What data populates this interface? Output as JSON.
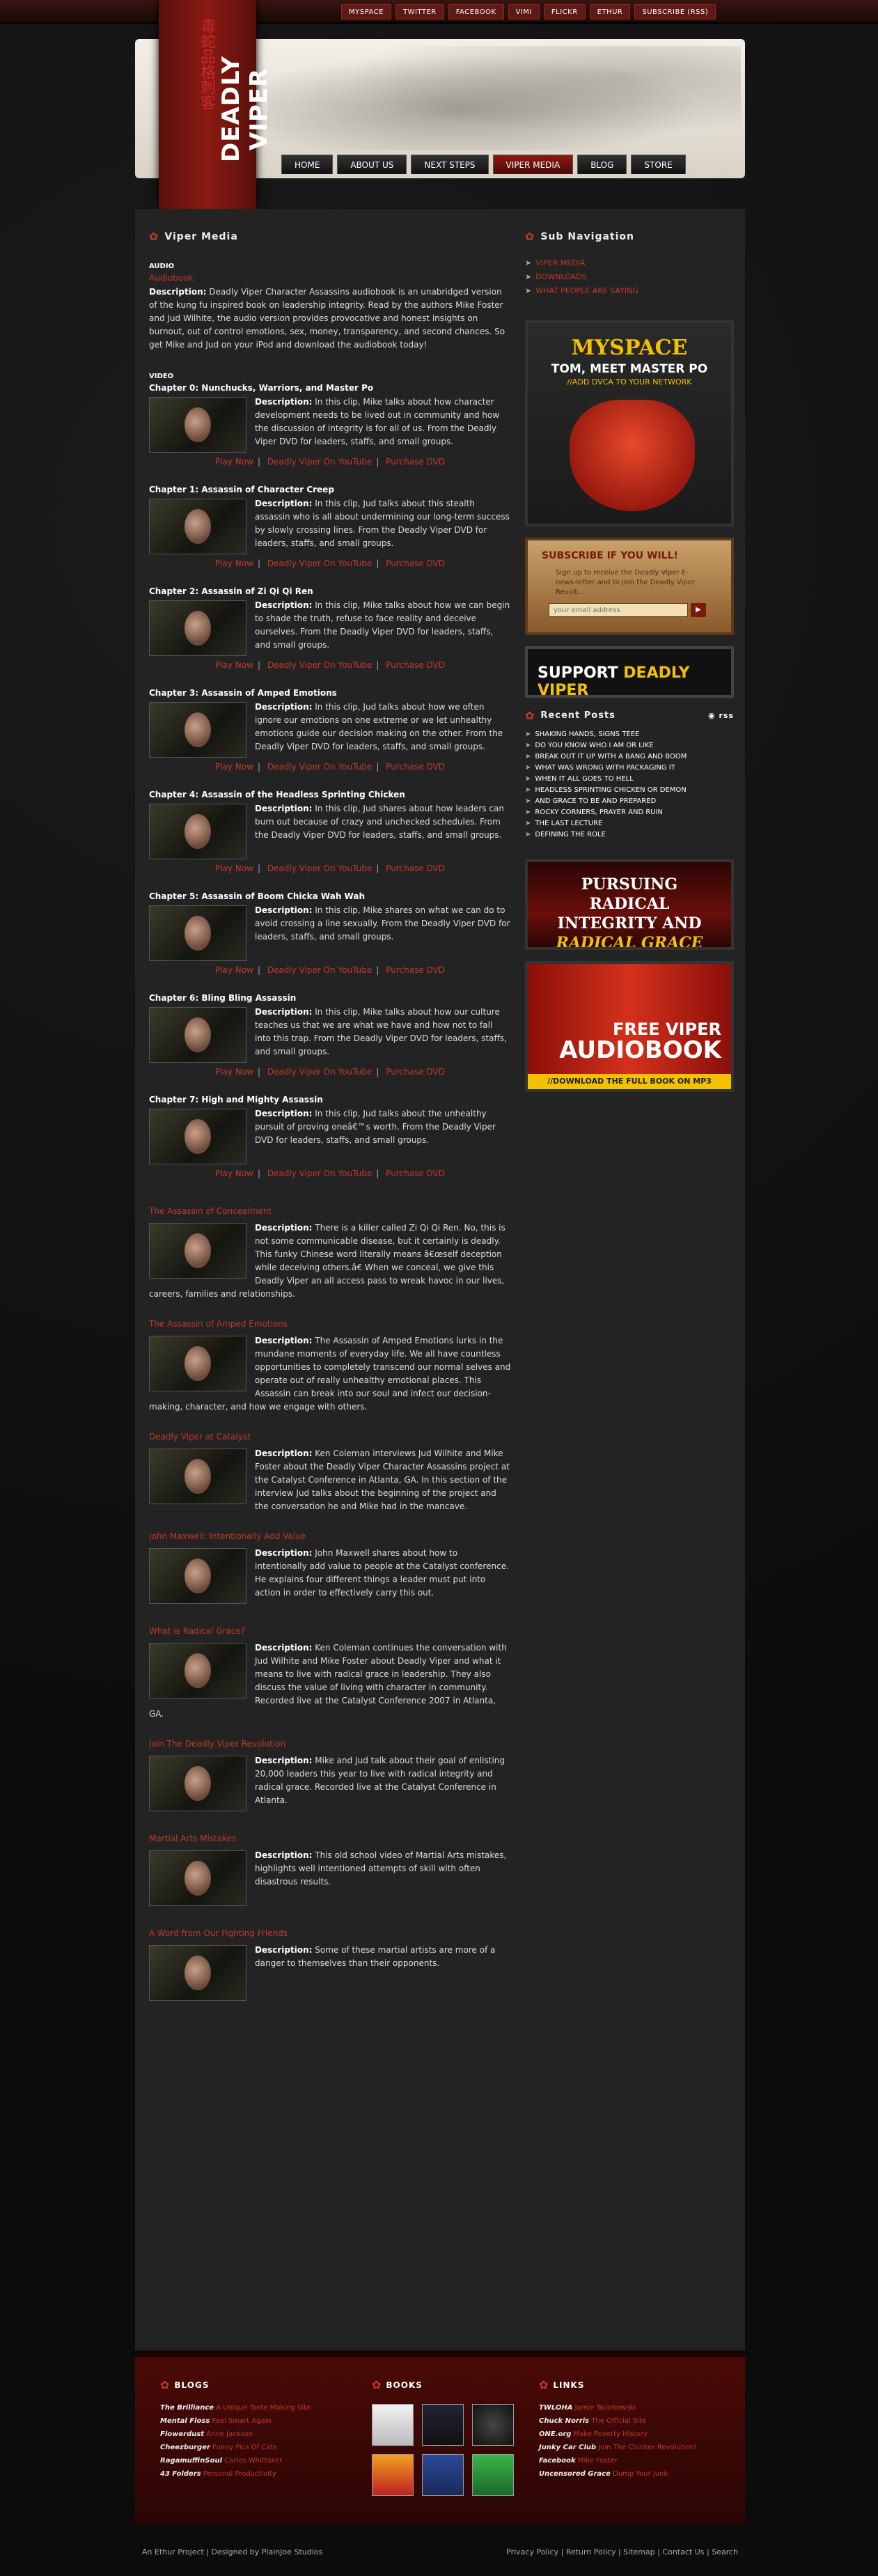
{
  "topnav": [
    "MYSPACE",
    "TWITTER",
    "FACEBOOK",
    "VIMI",
    "FLICKR",
    "ETHUR",
    "SUBSCRIBE (RSS)"
  ],
  "site": {
    "title": "DEADLY VIPER",
    "chinese": "毒蛇品格刺客"
  },
  "mainnav": [
    "HOME",
    "ABOUT US",
    "NEXT STEPS",
    "VIPER MEDIA",
    "BLOG",
    "STORE"
  ],
  "main": {
    "heading": "Viper Media",
    "audio_label": "AUDIO",
    "audio_link": "Audiobook",
    "audio_desc_label": "Description:",
    "audio_desc": "Deadly Viper Character Assassins audiobook is an unabridged version of the kung fu inspired book on leadership integrity. Read by the authors Mike Foster and Jud Wilhite, the audio version provides provocative and honest insights on burnout, out of control emotions, sex, money, transparency, and second chances. So get Mike and Jud on your iPod and download the audiobook today!",
    "video_label": "VIDEO",
    "desc_label": "Description:",
    "link_play": "Play Now",
    "link_youtube": "Deadly Viper On YouTube",
    "link_purchase": "Purchase DVD",
    "videos": [
      {
        "title": "Chapter 0: Nunchucks, Warriors, and Master Po",
        "desc": "In this clip, Mike talks about how character development needs to be lived out in community and how the discussion of integrity is for all of us. From the Deadly Viper DVD for leaders, staffs, and small groups."
      },
      {
        "title": "Chapter 1: Assassin of Character Creep",
        "desc": "In this clip, Jud talks about this stealth assassin who is all about undermining our long-term success by slowly crossing lines. From the Deadly Viper DVD for leaders, staffs, and small groups."
      },
      {
        "title": "Chapter 2: Assassin of Zi Qi Qi Ren",
        "desc": "In this clip, Mike talks about how we can begin to shade the truth, refuse to face reality and deceive ourselves. From the Deadly Viper DVD for leaders, staffs, and small groups."
      },
      {
        "title": "Chapter 3: Assassin of Amped Emotions",
        "desc": "In this clip, Jud talks about how we often ignore our emotions on one extreme or we let unhealthy emotions guide our decision making on the other. From the Deadly Viper DVD for leaders, staffs, and small groups."
      },
      {
        "title": "Chapter 4: Assassin of the Headless Sprinting Chicken",
        "desc": "In this clip, Jud shares about how leaders can burn out because of crazy and unchecked schedules. From the Deadly Viper DVD for leaders, staffs, and small groups."
      },
      {
        "title": "Chapter 5: Assassin of Boom Chicka Wah Wah",
        "desc": "In this clip, Mike shares on what we can do to avoid crossing a line sexually. From the Deadly Viper DVD for leaders, staffs, and small groups."
      },
      {
        "title": "Chapter 6: Bling Bling Assassin",
        "desc": "In this clip, Mike talks about how our culture teaches us that we are what we have and how not to fall into this trap. From the Deadly Viper DVD for leaders, staffs, and small groups."
      },
      {
        "title": "Chapter 7: High and Mighty Assassin",
        "desc": "In this clip, Jud talks about the unhealthy pursuit of proving oneâ€™s worth. From the Deadly Viper DVD for leaders, staffs, and small groups."
      }
    ],
    "articles": [
      {
        "title": "The Assassin of Concealment",
        "desc": "There is a killer called Zi Qi Qi Ren. No, this is not some communicable disease, but it certainly is deadly. This funky Chinese word literally means â€œself deception while deceiving others.â€ When we conceal, we give this Deadly Viper an all access pass to wreak havoc in our lives, careers, families and relationships."
      },
      {
        "title": "The Assassin of Amped Emotions",
        "desc": "The Assassin of Amped Emotions lurks in the mundane moments of everyday life. We all have countless opportunities to completely transcend our normal selves and operate out of really unhealthy emotional places. This Assassin can break into our soul and infect our decision-making, character, and how we engage with others."
      },
      {
        "title": "Deadly Viper at Catalyst",
        "desc": "Ken Coleman interviews Jud Wilhite and Mike Foster about the Deadly Viper Character Assassins project at the Catalyst Conference in Atlanta, GA. In this section of the interview Jud talks about the beginning of the project and the conversation he and Mike had in the mancave."
      },
      {
        "title": "John Maxwell: Intentionally Add Value",
        "desc": "John Maxwell shares about how to intentionally add value to people at the Catalyst conference. He explains four different things a leader must put into action in order to effectively carry this out."
      },
      {
        "title": "What is Radical Grace?",
        "desc": "Ken Coleman continues the conversation with Jud Wilhite and Mike Foster about Deadly Viper and what it means to live with radical grace in leadership. They also discuss the value of living with character in community. Recorded live at the Catalyst Conference 2007 in Atlanta, GA."
      },
      {
        "title": "Join The Deadly Viper Revolution",
        "desc": "Mike and Jud talk about their goal of enlisting 20,000 leaders this year to live with radical integrity and radical grace. Recorded live at the Catalyst Conference in Atlanta."
      },
      {
        "title": "Martial Arts Mistakes",
        "desc": "This old school video of Martial Arts mistakes, highlights well intentioned attempts of skill with often disastrous results."
      },
      {
        "title": "A Word from Our Fighting Friends",
        "desc": "Some of these martial artists are more of a danger to themselves than their opponents."
      }
    ]
  },
  "sidebar": {
    "subnav_heading": "Sub Navigation",
    "subnav": [
      "VIPER MEDIA",
      "DOWNLOADS",
      "WHAT PEOPLE ARE SAYING"
    ],
    "myspace": {
      "title": "MYSPACE",
      "sub": "TOM, MEET MASTER PO",
      "sub2": "//ADD DVCA TO YOUR NETWORK"
    },
    "subscribe": {
      "title": "SUBSCRIBE IF YOU WILL!",
      "text": "Sign up to receive the Deadly Viper E-news-letter and to join the Deadly Viper Revolt...",
      "placeholder": "your email address"
    },
    "support": {
      "a": "SUPPORT",
      "b": "DEADLY VIPER"
    },
    "recent_heading": "Recent Posts",
    "rss": "rss",
    "recent": [
      "SHAKING HANDS, SIGNS TEEE",
      "DO YOU KNOW WHO I AM OR LIKE",
      "BREAK OUT IT UP WITH A BANG AND BOOM",
      "WHAT WAS WRONG WITH PACKAGING IT",
      "WHEN IT ALL GOES TO HELL",
      "HEADLESS SPRINTING CHICKEN OR DEMON",
      "AND GRACE TO BE AND PREPARED",
      "ROCKY CORNERS, PRAYER AND RUIN",
      "THE LAST LECTURE",
      "DEFINING THE ROLE"
    ],
    "radical": {
      "l1": "PURSUING RADICAL",
      "l2": "INTEGRITY AND",
      "l3": "RADICAL GRACE"
    },
    "audiobook": {
      "l1": "FREE VIPER",
      "l2": "AUDIOBOOK",
      "l3": "//DOWNLOAD THE FULL BOOK ON MP3"
    }
  },
  "footer": {
    "blogs_heading": "BLOGS",
    "books_heading": "BOOKS",
    "links_heading": "LINKS",
    "blogs": [
      {
        "name": "The Brilliance",
        "text": "A Unique Taste Making Site"
      },
      {
        "name": "Mental Floss",
        "text": "Feel Smart Again"
      },
      {
        "name": "Flowerdust",
        "text": "Anne Jackson"
      },
      {
        "name": "Cheezburger",
        "text": "Funny Pics Of Cats"
      },
      {
        "name": "RagamuffinSoul",
        "text": "Carlos Whittaker"
      },
      {
        "name": "43 Folders",
        "text": "Personal Productivity"
      }
    ],
    "links": [
      {
        "name": "TWLOHA",
        "text": "Jamie Tworkowski"
      },
      {
        "name": "Chuck Norris",
        "text": "The Official Site"
      },
      {
        "name": "ONE.org",
        "text": "Make Poverty History"
      },
      {
        "name": "Junky Car Club",
        "text": "Join The Clunker Revolution!"
      },
      {
        "name": "Facebook",
        "text": "Mike Foster"
      },
      {
        "name": "Uncensored Grace",
        "text": "Dump Your Junk"
      }
    ]
  },
  "bottom": {
    "left": "An Ethur Project | Designed by PlainJoe Studios",
    "right": [
      "Privacy Policy",
      "Return Policy",
      "Sitemap",
      "Contact Us",
      "Search"
    ]
  },
  "colors": {
    "accent": "#c0392b",
    "brand_red": "#8a1a12",
    "yellow": "#f2c200"
  }
}
